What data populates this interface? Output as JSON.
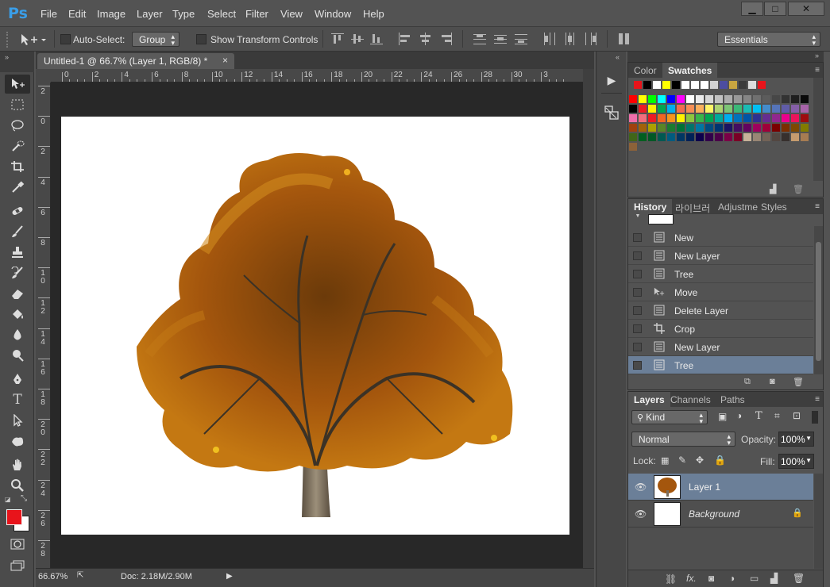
{
  "app": {
    "logo": "Ps"
  },
  "menu": [
    "File",
    "Edit",
    "Image",
    "Layer",
    "Type",
    "Select",
    "Filter",
    "View",
    "Window",
    "Help"
  ],
  "window_buttons": {
    "minimize": "▁",
    "restore": "□",
    "close": "✕"
  },
  "options": {
    "auto_select_label": "Auto-Select:",
    "auto_select_value": "Group",
    "show_transform_label": "Show Transform Controls",
    "workspace": "Essentials"
  },
  "document": {
    "tab_title": "Untitled-1 @ 66.7% (Layer 1, RGB/8) *",
    "tab_close": "×",
    "zoom": "66.67%",
    "doc_size": "Doc: 2.18M/2.90M"
  },
  "ruler": {
    "h_ticks": [
      "0",
      "2",
      "4",
      "6",
      "8",
      "10",
      "12",
      "14",
      "16",
      "18",
      "20",
      "22",
      "24",
      "26",
      "28",
      "30",
      "3"
    ],
    "v_ticks": [
      "2",
      "0",
      "2",
      "4",
      "6",
      "8",
      "1 0",
      "1 2",
      "1 4",
      "1 6",
      "1 8",
      "2 0",
      "2 2",
      "2 4",
      "2 6",
      "2 8"
    ]
  },
  "colors": {
    "foreground": "#e8141b",
    "background": "#ffffff",
    "selection": "#6b7f98",
    "accent_logo": "#3a9ee8"
  },
  "swatches_panel": {
    "tabs": [
      "Color",
      "Swatches"
    ],
    "active_tab": "Swatches",
    "recent": [
      "#e8141b",
      "#000000",
      "#ffffff",
      "#ffff00",
      "#000000",
      "#ffffff",
      "#ffffff",
      "#ffffff",
      "#d2d2d2",
      "#4d4da0",
      "#c9a640",
      "#3a3a3a",
      "#dcdcdc",
      "#e8141b"
    ],
    "grid": [
      [
        "#ff0000",
        "#ffff00",
        "#00ff00",
        "#00ffff",
        "#0000ff",
        "#ff00ff",
        "#ffffff",
        "#ebebeb",
        "#d6d6d6",
        "#c2c2c2",
        "#adadad",
        "#999999",
        "#858585",
        "#707070",
        "#5c5c5c",
        "#474747",
        "#333333",
        "#1f1f1f",
        "#0a0a0a",
        "#000000",
        "#ed1c24",
        "#fff200",
        "#00a651",
        "#00aeef"
      ],
      [
        "#f26c4f",
        "#f68e55",
        "#fbaf5c",
        "#fff467",
        "#acd372",
        "#7cc576",
        "#3bb878",
        "#1abbb4",
        "#00bff3",
        "#438ccb",
        "#5574b9",
        "#605ca8",
        "#855fa8",
        "#a763a8",
        "#f06eaa",
        "#f26d7d",
        "#ed1c24",
        "#f26522",
        "#f7941d",
        "#fff200",
        "#8dc63f",
        "#39b54a",
        "#00a651",
        "#00a99d"
      ],
      [
        "#00aeef",
        "#0072bc",
        "#0054a6",
        "#2e3192",
        "#662d91",
        "#92278f",
        "#ec008c",
        "#ed145b",
        "#9e0b0f",
        "#a0410d",
        "#a36209",
        "#aba000",
        "#598527",
        "#1a7b30",
        "#007236",
        "#00746b",
        "#0076a3",
        "#004b80",
        "#003471",
        "#1b1464",
        "#440e62",
        "#630460",
        "#9e005d",
        "#9e0039"
      ],
      [
        "#790000",
        "#7b2e00",
        "#7d4900",
        "#827b00",
        "#406618",
        "#005e20",
        "#005826",
        "#005952",
        "#005b7f",
        "#003663",
        "#002157",
        "#0d004c",
        "#32004b",
        "#4b0049",
        "#7b0046",
        "#7a0026",
        "#c7b299",
        "#998675",
        "#736357",
        "#534741",
        "#37302d",
        "#c69c6e",
        "#a67c52",
        "#8c6239"
      ]
    ]
  },
  "history_panel": {
    "tabs": [
      "History",
      "라이브러",
      "Adjustme",
      "Styles"
    ],
    "active_tab": "History",
    "items": [
      {
        "label": "New",
        "icon": "document-icon"
      },
      {
        "label": "New Layer",
        "icon": "document-icon"
      },
      {
        "label": "Tree",
        "icon": "document-icon"
      },
      {
        "label": "Move",
        "icon": "move-tool-icon"
      },
      {
        "label": "Delete Layer",
        "icon": "document-icon"
      },
      {
        "label": "Crop",
        "icon": "crop-tool-icon"
      },
      {
        "label": "New Layer",
        "icon": "document-icon"
      },
      {
        "label": "Tree",
        "icon": "document-icon"
      }
    ],
    "selected_index": 7
  },
  "layers_panel": {
    "tabs": [
      "Layers",
      "Channels",
      "Paths"
    ],
    "active_tab": "Layers",
    "filter_kind": "Kind",
    "blend_mode": "Normal",
    "opacity_label": "Opacity:",
    "opacity_value": "100%",
    "lock_label": "Lock:",
    "fill_label": "Fill:",
    "fill_value": "100%",
    "layers": [
      {
        "name": "Layer 1",
        "selected": true
      },
      {
        "name": "Background",
        "selected": false,
        "locked": true
      }
    ]
  }
}
